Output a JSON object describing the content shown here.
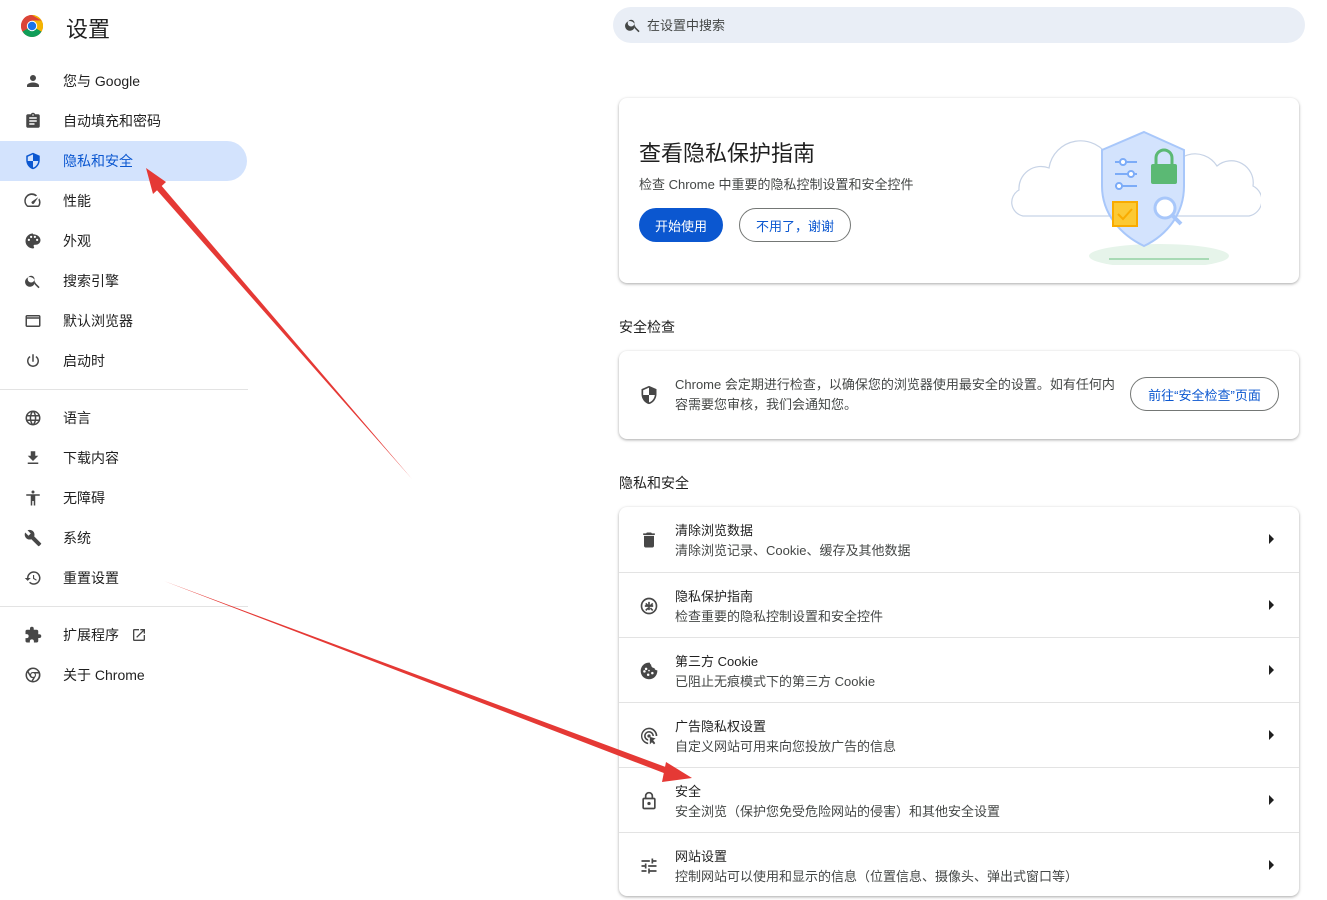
{
  "header": {
    "title": "设置",
    "search_placeholder": "在设置中搜索"
  },
  "sidebar": {
    "items": [
      {
        "label": "您与 Google",
        "icon": "person-icon"
      },
      {
        "label": "自动填充和密码",
        "icon": "clipboard-icon"
      },
      {
        "label": "隐私和安全",
        "icon": "shield-icon",
        "active": true
      },
      {
        "label": "性能",
        "icon": "speedometer-icon"
      },
      {
        "label": "外观",
        "icon": "palette-icon"
      },
      {
        "label": "搜索引擎",
        "icon": "search-icon"
      },
      {
        "label": "默认浏览器",
        "icon": "browser-window-icon"
      },
      {
        "label": "启动时",
        "icon": "power-icon"
      },
      {
        "label": "语言",
        "icon": "globe-icon"
      },
      {
        "label": "下载内容",
        "icon": "download-icon"
      },
      {
        "label": "无障碍",
        "icon": "accessibility-icon"
      },
      {
        "label": "系统",
        "icon": "wrench-icon"
      },
      {
        "label": "重置设置",
        "icon": "history-icon"
      },
      {
        "label": "扩展程序",
        "icon": "puzzle-icon"
      },
      {
        "label": "关于 Chrome",
        "icon": "chrome-icon"
      }
    ]
  },
  "promo": {
    "title": "查看隐私保护指南",
    "description": "检查 Chrome 中重要的隐私控制设置和安全控件",
    "start_button": "开始使用",
    "dismiss_button": "不用了，谢谢"
  },
  "safety_check": {
    "section_title": "安全检查",
    "text": "Chrome 会定期进行检查，以确保您的浏览器使用最安全的设置。如有任何内容需要您审核，我们会通知您。",
    "button": "前往“安全检查”页面"
  },
  "privacy": {
    "section_title": "隐私和安全",
    "rows": [
      {
        "title": "清除浏览数据",
        "subtitle": "清除浏览记录、Cookie、缓存及其他数据",
        "icon": "trash-icon"
      },
      {
        "title": "隐私保护指南",
        "subtitle": "检查重要的隐私控制设置和安全控件",
        "icon": "compass-icon"
      },
      {
        "title": "第三方 Cookie",
        "subtitle": "已阻止无痕模式下的第三方 Cookie",
        "icon": "cookie-icon"
      },
      {
        "title": "广告隐私权设置",
        "subtitle": "自定义网站可用来向您投放广告的信息",
        "icon": "ad-privacy-icon"
      },
      {
        "title": "安全",
        "subtitle": "安全浏览（保护您免受危险网站的侵害）和其他安全设置",
        "icon": "lock-icon"
      },
      {
        "title": "网站设置",
        "subtitle": "控制网站可以使用和显示的信息（位置信息、摄像头、弹出式窗口等）",
        "icon": "sliders-icon"
      }
    ]
  },
  "colors": {
    "accent": "#0b57d0",
    "active_bg": "#d3e3fd",
    "annotation_arrow": "#e53935"
  }
}
